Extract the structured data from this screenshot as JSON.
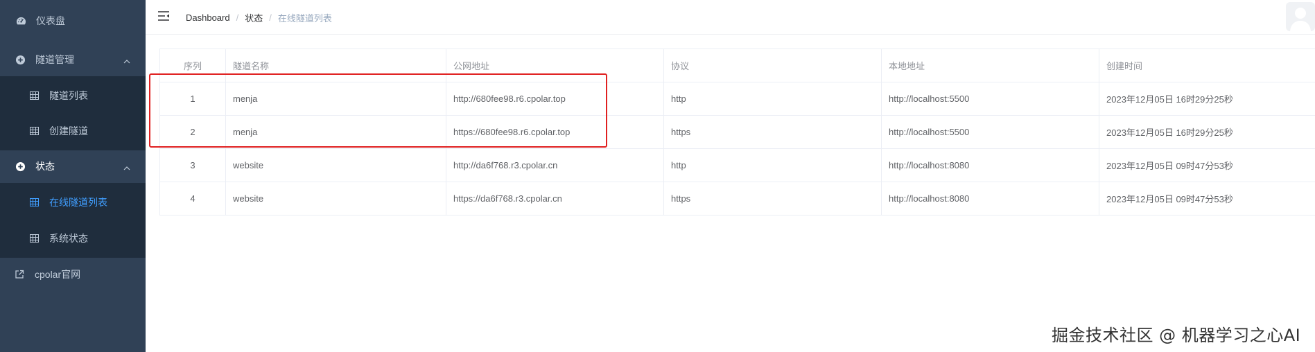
{
  "sidebar": {
    "dashboard": "仪表盘",
    "tunnel_mgmt": "隧道管理",
    "tunnel_list": "隧道列表",
    "create_tunnel": "创建隧道",
    "status": "状态",
    "online_tunnel_list": "在线隧道列表",
    "system_status": "系统状态",
    "cpolar_site": "cpolar官网"
  },
  "breadcrumb": {
    "home": "Dashboard",
    "sep": "/",
    "parent": "状态",
    "current": "在线隧道列表"
  },
  "table": {
    "headers": [
      "序列",
      "隧道名称",
      "公网地址",
      "协议",
      "本地地址",
      "创建时间"
    ],
    "rows": [
      [
        "1",
        "menja",
        "http://680fee98.r6.cpolar.top",
        "http",
        "http://localhost:5500",
        "2023年12月05日 16时29分25秒"
      ],
      [
        "2",
        "menja",
        "https://680fee98.r6.cpolar.top",
        "https",
        "http://localhost:5500",
        "2023年12月05日 16时29分25秒"
      ],
      [
        "3",
        "website",
        "http://da6f768.r3.cpolar.cn",
        "http",
        "http://localhost:8080",
        "2023年12月05日 09时47分53秒"
      ],
      [
        "4",
        "website",
        "https://da6f768.r3.cpolar.cn",
        "https",
        "http://localhost:8080",
        "2023年12月05日 09时47分53秒"
      ]
    ]
  },
  "watermark": "掘金技术社区 @ 机器学习之心AI",
  "colors": {
    "sidebar_bg": "#304156",
    "submenu_bg": "#1f2d3d",
    "active": "#409eff",
    "highlight_box": "#e02020"
  },
  "icons": {
    "dashboard": "dashboard-icon",
    "tunnel_mgmt": "plus-circle-icon",
    "table": "table-icon",
    "status": "plus-circle-icon",
    "external": "external-link-icon",
    "menu": "menu-fold-icon"
  }
}
